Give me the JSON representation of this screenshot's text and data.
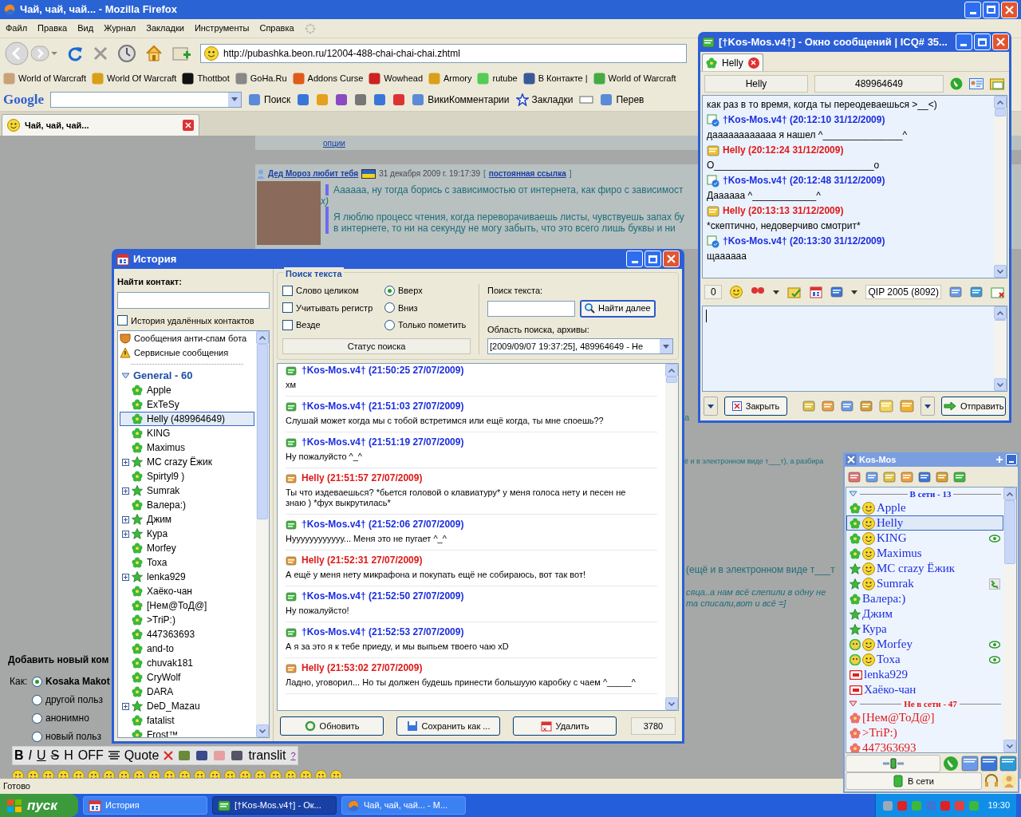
{
  "browser": {
    "title": "Чай, чай, чай... - Mozilla Firefox",
    "menu": [
      "Файл",
      "Правка",
      "Вид",
      "Журнал",
      "Закладки",
      "Инструменты",
      "Справка"
    ],
    "url": "http://pubashka.beon.ru/12004-488-chai-chai-chai.zhtml",
    "bookmarks": [
      "World of Warcraft",
      "World Of Warcraft",
      "Thottbot",
      "GoHa.Ru",
      "Addons Curse",
      "Wowhead",
      "Armory",
      "rutube",
      "В Контакте |",
      "World of Warcraft"
    ],
    "google_toolbar": {
      "logo": "Google",
      "items": [
        "Поиск",
        "ВикиКомментарии",
        "Закладки",
        "Перев"
      ]
    },
    "tab": {
      "label": "Чай, чай, чай..."
    },
    "status_bar": "Готово"
  },
  "page": {
    "top_link": "опции",
    "post": {
      "author": "Дед Мороз любит тебя",
      "date": "31 декабря 2009 г. 19:17:39",
      "permalink_open": "[",
      "permalink": "постоянная ссылка",
      "permalink_close": "]",
      "quotes": [
        "Аааааа, ну тогда борись с зависимостью от интернета, как фиро с зависимост",
        "Я люблю процесс чтения, когда переворачиваешь листы, чувствуешь запах бу"
      ],
      "after_quote": "x)",
      "second_line": "в интернете, то ни на секунду не могу забыть, что это всего лишь буквы и ни"
    },
    "fragments": [
      "а",
      "ё и в электронном виде т___т), а разбира",
      "(ещё и в электронном виде т___т",
      "сяца..а нам всё слепили в одну не",
      "та списали,вот и всё =]"
    ],
    "comment_form": {
      "heading": "Добавить новый ком",
      "as_label": "Как:",
      "options": [
        {
          "label": "Kosaka Makot",
          "selected": true
        },
        {
          "label": "другой польз",
          "selected": false
        },
        {
          "label": "анонимно",
          "selected": false
        },
        {
          "label": "новый польз",
          "selected": false
        }
      ],
      "toolbar": [
        "B",
        "I",
        "U",
        "S",
        "H",
        "OFF",
        "Quote",
        "translit",
        "?"
      ]
    }
  },
  "history": {
    "title": "История",
    "find_label": "Найти контакт:",
    "deleted_checkbox": {
      "label": "История удалённых контактов",
      "checked": false
    },
    "special": [
      "Сообщения анти-спам бота",
      "Сервисные сообщения"
    ],
    "group": {
      "label": "General - 60",
      "expanded": true
    },
    "contacts": [
      {
        "name": "Apple",
        "kind": "flower",
        "expandable": false,
        "selected": false
      },
      {
        "name": "ExTeSy",
        "kind": "flower",
        "expandable": false,
        "selected": false
      },
      {
        "name": "Helly (489964649)",
        "kind": "flower",
        "expandable": false,
        "selected": true
      },
      {
        "name": "KING",
        "kind": "flower",
        "expandable": false,
        "selected": false
      },
      {
        "name": "Maximus",
        "kind": "flower",
        "expandable": false,
        "selected": false
      },
      {
        "name": "MC crazy Ёжик",
        "kind": "star",
        "expandable": true,
        "selected": false
      },
      {
        "name": "Spirtyl9 )",
        "kind": "flower",
        "expandable": false,
        "selected": false
      },
      {
        "name": "Sumrak",
        "kind": "star",
        "expandable": true,
        "selected": false
      },
      {
        "name": "Валера:)",
        "kind": "flower",
        "expandable": false,
        "selected": false
      },
      {
        "name": "Джим",
        "kind": "star",
        "expandable": true,
        "selected": false
      },
      {
        "name": "Кура",
        "kind": "star",
        "expandable": true,
        "selected": false
      },
      {
        "name": "Morfey",
        "kind": "flower",
        "expandable": false,
        "selected": false
      },
      {
        "name": "Toxa",
        "kind": "flower",
        "expandable": false,
        "selected": false
      },
      {
        "name": "lenka929",
        "kind": "star",
        "expandable": true,
        "selected": false
      },
      {
        "name": "Хаёко-чан",
        "kind": "flower",
        "expandable": false,
        "selected": false
      },
      {
        "name": "[Нем@ToД@]",
        "kind": "flower",
        "expandable": false,
        "selected": false
      },
      {
        "name": ">TriP:)",
        "kind": "flower",
        "expandable": false,
        "selected": false
      },
      {
        "name": "447363693",
        "kind": "flower",
        "expandable": false,
        "selected": false
      },
      {
        "name": "and-to",
        "kind": "flower",
        "expandable": false,
        "selected": false
      },
      {
        "name": "chuvak181",
        "kind": "flower",
        "expandable": false,
        "selected": false
      },
      {
        "name": "CryWolf",
        "kind": "flower",
        "expandable": false,
        "selected": false
      },
      {
        "name": "DARA",
        "kind": "flower",
        "expandable": false,
        "selected": false
      },
      {
        "name": "DeD_Mazau",
        "kind": "star",
        "expandable": true,
        "selected": false
      },
      {
        "name": "fatalist",
        "kind": "flower",
        "expandable": false,
        "selected": false
      },
      {
        "name": "Frost™",
        "kind": "flower",
        "expandable": false,
        "selected": false
      }
    ],
    "search": {
      "legend": "Поиск текста",
      "checkboxes": [
        {
          "label": "Слово целиком",
          "checked": false
        },
        {
          "label": "Учитывать регистр",
          "checked": false
        },
        {
          "label": "Везде",
          "checked": false
        }
      ],
      "radios": [
        {
          "label": "Вверх",
          "selected": true
        },
        {
          "label": "Вниз",
          "selected": false
        },
        {
          "label": "Только пометить",
          "selected": false
        }
      ],
      "status": "Статус поиска",
      "text_label": "Поиск текста:",
      "find_button": "Найти далее",
      "scope_label": "Область поиска, архивы:",
      "scope_value": "[2009/09/07 19:37:25], 489964649 - He"
    },
    "messages": [
      {
        "kind": "outgoing",
        "header": "†Kos-Mos.v4† (21:50:25 27/07/2009)",
        "text": "хм"
      },
      {
        "kind": "outgoing",
        "header": "†Kos-Mos.v4† (21:51:03 27/07/2009)",
        "text": "Слушай может когда мы с тобой встретимся или ещё когда, ты мне споешь??"
      },
      {
        "kind": "outgoing",
        "header": "†Kos-Mos.v4† (21:51:19 27/07/2009)",
        "text": "Ну пожалуйсто ^_^"
      },
      {
        "kind": "incoming",
        "header": "Helly (21:51:57 27/07/2009)",
        "text": "Ты что издеваешься? *бьется головой о клавиатуру* у меня голоса нету и песен не знаю ) *фух выкрутилась*"
      },
      {
        "kind": "outgoing",
        "header": "†Kos-Mos.v4† (21:52:06 27/07/2009)",
        "text": "Нуууууууууууу... Меня это не пугает ^_^"
      },
      {
        "kind": "incoming",
        "header": "Helly (21:52:31 27/07/2009)",
        "text": "А ещё у меня нету микрафона и покупать ещё не собираюсь, вот так вот!"
      },
      {
        "kind": "outgoing",
        "header": "†Kos-Mos.v4† (21:52:50 27/07/2009)",
        "text": "Ну пожалуйсто!"
      },
      {
        "kind": "outgoing",
        "header": "†Kos-Mos.v4† (21:52:53 27/07/2009)",
        "text": "А я за это я к тебе приеду, и мы выпьем твоего чаю xD"
      },
      {
        "kind": "incoming",
        "header": "Helly (21:53:02 27/07/2009)",
        "text": "Ладно, уговорил... Но ты должен будешь принести большуую каробку с чаем ^_____^"
      }
    ],
    "buttons": [
      "Обновить",
      "Сохранить как ...",
      "Удалить"
    ],
    "count": "3780"
  },
  "message_window": {
    "title": "[†Kos-Mos.v4†] - Окно сообщений | ICQ# 35...",
    "tab": "Helly",
    "name": "Helly",
    "uin": "489964649",
    "first_line": "как раз в то время, когда ты переодеваешься >__<)",
    "messages": [
      {
        "kind": "outgoing",
        "header": "†Kos-Mos.v4† (20:12:10 31/12/2009)",
        "text": "даааааааааааа я нашел ^_______________^"
      },
      {
        "kind": "incoming",
        "header": "Helly (20:12:24 31/12/2009)",
        "text": "O______________________________o"
      },
      {
        "kind": "outgoing",
        "header": "†Kos-Mos.v4† (20:12:48 31/12/2009)",
        "text": "Дааааaa ^____________^"
      },
      {
        "kind": "incoming",
        "header": "Helly (20:13:13 31/12/2009)",
        "text": "*скептично, недоверчиво смотрит*"
      },
      {
        "kind": "outgoing",
        "header": "†Kos-Mos.v4† (20:13:30 31/12/2009)",
        "text": "щаааааа"
      }
    ],
    "counter": "0",
    "client": "QIP 2005 (8092)",
    "close_button": "Закрыть",
    "send_button": "Отправить"
  },
  "contact_list": {
    "title": "Kos-Mos",
    "groups": [
      {
        "label": "В сети - 13",
        "online": true,
        "expanded": true,
        "contacts": [
          {
            "name": "Apple",
            "kind": "online",
            "avatar": true,
            "eye": false,
            "phone": false,
            "selected": false
          },
          {
            "name": "Helly",
            "kind": "online",
            "avatar": true,
            "eye": false,
            "phone": false,
            "selected": true
          },
          {
            "name": "KING",
            "kind": "online",
            "avatar": true,
            "eye": true,
            "phone": false,
            "selected": false
          },
          {
            "name": "Maximus",
            "kind": "online",
            "avatar": true,
            "eye": false,
            "phone": false,
            "selected": false
          },
          {
            "name": "MC crazy Ёжик",
            "kind": "free",
            "avatar": true,
            "eye": false,
            "phone": false,
            "selected": false
          },
          {
            "name": "Sumrak",
            "kind": "free",
            "avatar": true,
            "eye": false,
            "phone": true,
            "selected": false
          },
          {
            "name": "Валера:)",
            "kind": "online",
            "avatar": false,
            "eye": false,
            "phone": false,
            "selected": false
          },
          {
            "name": "Джим",
            "kind": "free",
            "avatar": false,
            "eye": false,
            "phone": false,
            "selected": false
          },
          {
            "name": "Кура",
            "kind": "free",
            "avatar": false,
            "eye": false,
            "phone": false,
            "selected": false
          },
          {
            "name": "Morfey",
            "kind": "away",
            "avatar": true,
            "eye": true,
            "phone": false,
            "selected": false
          },
          {
            "name": "Toxa",
            "kind": "away",
            "avatar": true,
            "eye": true,
            "phone": false,
            "selected": false
          },
          {
            "name": "lenka929",
            "kind": "na",
            "avatar": false,
            "eye": false,
            "phone": false,
            "selected": false
          },
          {
            "name": "Хаёко-чан",
            "kind": "na",
            "avatar": false,
            "eye": false,
            "phone": false,
            "selected": false
          }
        ]
      },
      {
        "label": "Не в сети - 47",
        "online": false,
        "expanded": true,
        "contacts": [
          {
            "name": "[Нем@ToД@]",
            "kind": "offline",
            "avatar": false,
            "eye": false,
            "phone": false,
            "selected": false
          },
          {
            "name": ">TriP:)",
            "kind": "offline",
            "avatar": false,
            "eye": false,
            "phone": false,
            "selected": false
          },
          {
            "name": "447363693",
            "kind": "offline",
            "avatar": false,
            "eye": false,
            "phone": false,
            "selected": false
          }
        ]
      }
    ],
    "status_button": "В сети"
  },
  "taskbar": {
    "start": "пуск",
    "items": [
      {
        "label": "История",
        "selected": false
      },
      {
        "label": "[†Kos-Mos.v4†] - Ок...",
        "selected": true
      },
      {
        "label": "Чай, чай, чай... - M...",
        "selected": false
      }
    ],
    "clock": "19:30"
  }
}
